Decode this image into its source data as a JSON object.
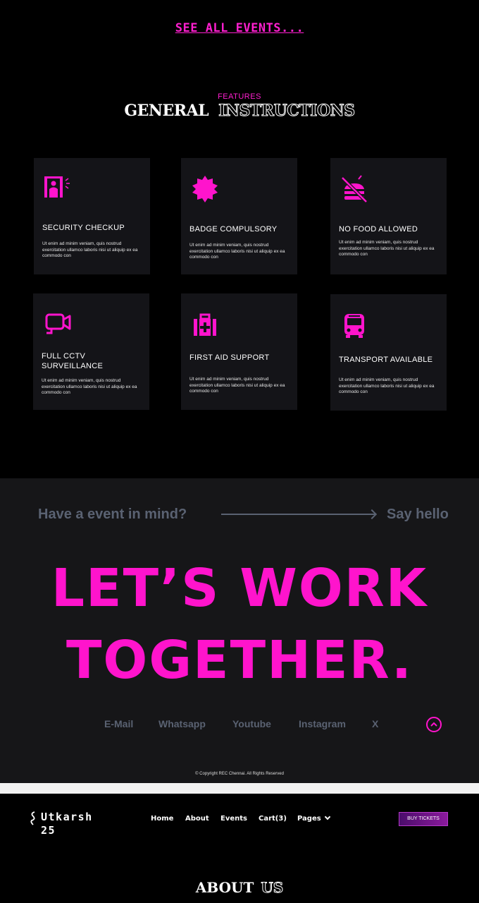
{
  "events_link": "SEE ALL EVENTS...",
  "features": {
    "eyebrow": "FEATURES",
    "title_word1": "GENERAL",
    "title_word2": "INSTRUCTIONS",
    "cards": [
      {
        "icon": "security-gate-icon",
        "title": "SECURITY CHECKUP",
        "desc": "Ut enim ad minim veniam, quis nostrud exercitation ullamco laboris nisi ut aliquip ex ea commodo con"
      },
      {
        "icon": "badge-icon",
        "title": "BADGE COMPULSORY",
        "desc": "Ut enim ad minim veniam, quis nostrud exercitation ullamco laboris nisi ut aliquip ex ea commodo con"
      },
      {
        "icon": "no-food-icon",
        "title": "NO FOOD ALLOWED",
        "desc": "Ut enim ad minim veniam, quis nostrud exercitation ullamco laboris nisi ut aliquip ex ea commodo con"
      },
      {
        "icon": "cctv-camera-icon",
        "title": "FULL CCTV SURVEILLANCE",
        "desc": "Ut enim ad minim veniam, quis nostrud exercitation ullamco laboris nisi ut aliquip ex ea commodo con"
      },
      {
        "icon": "first-aid-kit-icon",
        "title": "FIRST AID SUPPORT",
        "desc": "Ut enim ad minim veniam, quis nostrud exercitation ullamco laboris nisi ut aliquip ex ea commodo con"
      },
      {
        "icon": "bus-icon",
        "title": "TRANSPORT AVAILABLE",
        "desc": "Ut enim ad minim veniam, quis nostrud exercitation ullamco laboris nisi ut aliquip ex ea commodo con"
      }
    ]
  },
  "contact": {
    "prompt": "Have a event in mind?",
    "say_hello": "Say hello",
    "headline_line1": "LET’S WORK",
    "headline_line2": "TOGETHER.",
    "socials": [
      "E-Mail",
      "Whatsapp",
      "Youtube",
      "Instagram",
      "X"
    ],
    "copyright": "© Copyright REC Chennai. All Rights Reserved"
  },
  "navbar": {
    "logo_line1": "Utkarsh",
    "logo_line2": "25",
    "items": [
      "Home",
      "About",
      "Events",
      "Cart(3)",
      "Pages"
    ],
    "buy_tickets": "BUY TICKETS"
  },
  "about": {
    "title_word1": "ABOUT",
    "title_word2": "US"
  },
  "colors": {
    "accent": "#ff14cc",
    "card_bg": "#141418",
    "contact_bg": "#161618",
    "muted_text": "#5a6272"
  }
}
